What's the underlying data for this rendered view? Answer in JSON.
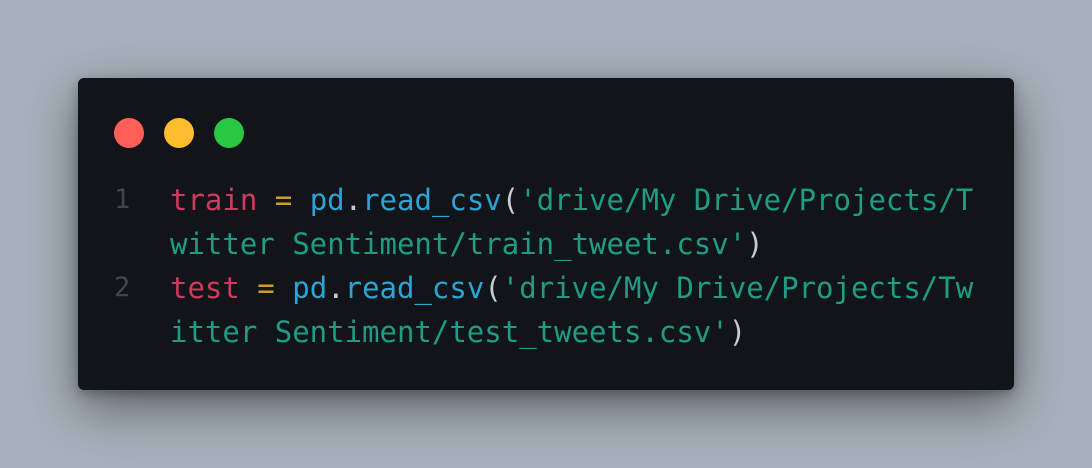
{
  "window": {
    "controls": [
      {
        "name": "close",
        "color": "#ff5f57"
      },
      {
        "name": "minimize",
        "color": "#febc2e"
      },
      {
        "name": "maximize",
        "color": "#28c840"
      }
    ]
  },
  "code": {
    "lines": [
      {
        "number": "1",
        "var": "train",
        "op": " = ",
        "module": "pd",
        "dot": ".",
        "func": "read_csv",
        "open": "(",
        "string": "'drive/My Drive/Projects/Twitter Sentiment/train_tweet.csv'",
        "close": ")"
      },
      {
        "number": "2",
        "var": "test",
        "op": " = ",
        "module": "pd",
        "dot": ".",
        "func": "read_csv",
        "open": "(",
        "string": "'drive/My Drive/Projects/Twitter Sentiment/test_tweets.csv'",
        "close": ")"
      }
    ]
  },
  "colors": {
    "background": "#a7b1bb",
    "editor_background": "#111418",
    "line_number": "#3f4650",
    "variable": "#d03a5e",
    "operator": "#d49a2a",
    "function": "#2aa5d6",
    "string": "#1f9d84",
    "punctuation": "#c7cdd4"
  }
}
